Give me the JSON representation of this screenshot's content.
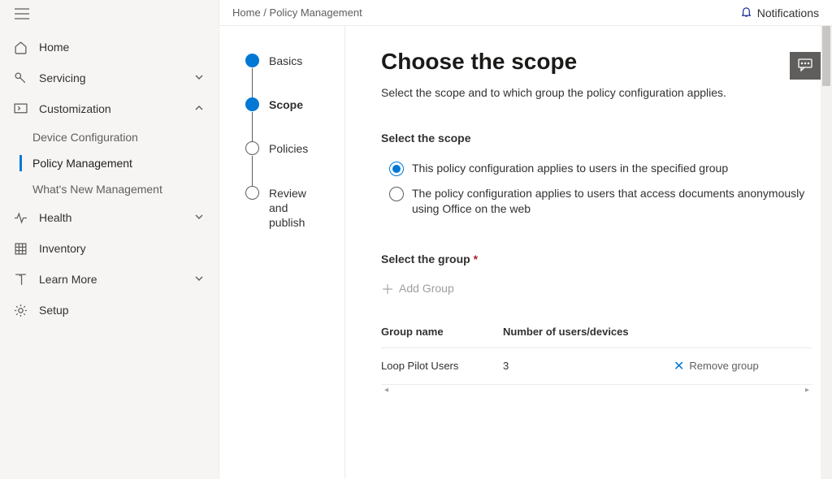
{
  "topbar": {
    "breadcrumb_home": "Home",
    "breadcrumb_sep": " / ",
    "breadcrumb_current": "Policy Management",
    "notifications": "Notifications"
  },
  "sidebar": {
    "home": "Home",
    "servicing": "Servicing",
    "customization": "Customization",
    "customization_items": {
      "device": "Device Configuration",
      "policy": "Policy Management",
      "whatsnew": "What's New Management"
    },
    "health": "Health",
    "inventory": "Inventory",
    "learn": "Learn More",
    "setup": "Setup"
  },
  "stepper": {
    "basics": "Basics",
    "scope": "Scope",
    "policies": "Policies",
    "review": "Review and publish"
  },
  "form": {
    "title": "Choose the scope",
    "subtitle": "Select the scope and to which group the policy configuration applies.",
    "scope_label": "Select the scope",
    "radio1": "This policy configuration applies to users in the specified group",
    "radio2": "The policy configuration applies to users that access documents anonymously using Office on the web",
    "group_label": "Select the group",
    "add_group": "Add Group",
    "col_name": "Group name",
    "col_count": "Number of users/devices",
    "row_name": "Loop Pilot Users",
    "row_count": "3",
    "remove": "Remove group"
  }
}
